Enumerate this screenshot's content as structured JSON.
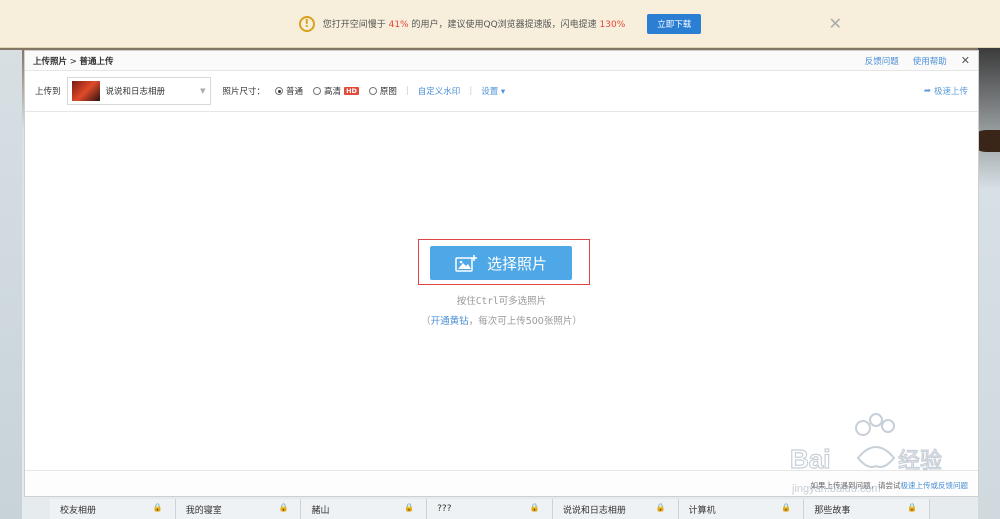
{
  "notice": {
    "text_before": "您打开空间慢于",
    "pct1": "41%",
    "text_mid": "的用户，建议使用QQ浏览器提速版，闪电提速",
    "pct2": "130%",
    "button": "立即下载"
  },
  "modal": {
    "breadcrumb_root": "上传照片",
    "breadcrumb_sep": ">",
    "breadcrumb_current": "普通上传",
    "feedback": "反馈问题",
    "help": "使用帮助"
  },
  "toolbar": {
    "upload_to_label": "上传到",
    "album_name": "说说和日志相册",
    "size_label": "照片尺寸：",
    "size_normal": "普通",
    "size_hd": "高清",
    "hd_badge": "HD",
    "size_original": "原图",
    "watermark_link": "自定义水印",
    "settings_link": "设置",
    "fast_upload": "极速上传"
  },
  "body": {
    "pick_button": "选择照片",
    "hint_ctrl": "按住Ctrl可多选照片",
    "hint_open": "（",
    "hint_link": "开通黄钻",
    "hint_rest": "，每次可上传500张照片）"
  },
  "footer": {
    "text": "如果上传遇到问题，请尝试",
    "link": "极速上传或反馈问题"
  },
  "strip": [
    "校友相册",
    "我的寝室",
    "赭山",
    "???",
    "说说和日志相册",
    "计算机",
    "那些故事"
  ],
  "colors": {
    "accent_blue": "#4ea7e6",
    "link_blue": "#4b8fd6",
    "highlight_red": "#e24a3a",
    "notice_bg": "#f7eedb"
  }
}
